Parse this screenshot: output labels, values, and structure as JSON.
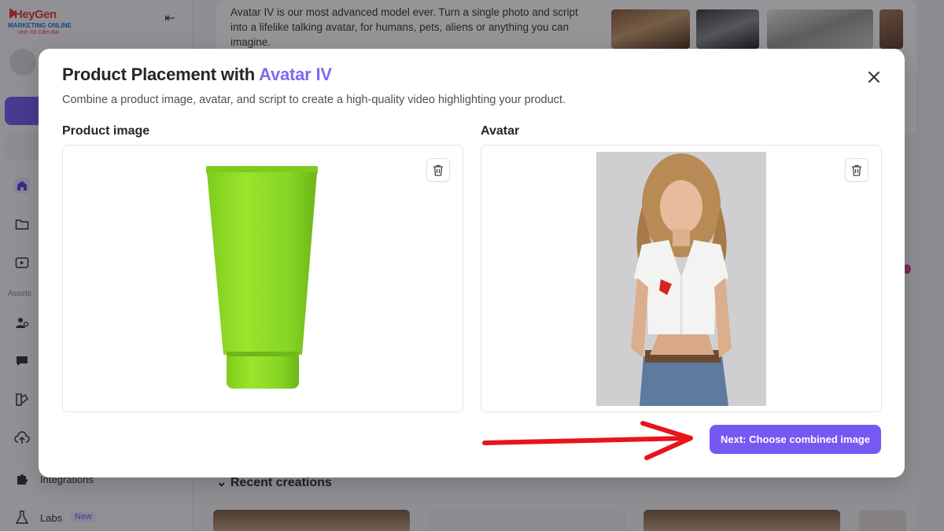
{
  "background": {
    "description_text": "Avatar IV is our most advanced model ever. Turn a single photo and script into a lifelike talking avatar, for humans, pets, aliens or anything you can imagine.",
    "logo": {
      "line1": "HeyGen",
      "line2": "MARKETING ONLINE",
      "line3": "Vinh Xô Cẩm Bài"
    },
    "sidebar": {
      "assets_label": "Assets",
      "integrations_label": "Integrations",
      "labs_label": "Labs",
      "labs_badge": "New",
      "icons": [
        "collapse-icon",
        "home-icon",
        "folder-icon",
        "video-icon",
        "avatar-icon",
        "chat-icon",
        "brand-kit-icon",
        "upload-icon",
        "puzzle-icon",
        "flask-icon"
      ]
    },
    "recent_creations_label": "Recent creations"
  },
  "modal": {
    "title_main": "Product Placement with ",
    "title_accent": "Avatar IV",
    "subtitle": "Combine a product image, avatar, and script to create a high-quality video highlighting your product.",
    "product_label": "Product image",
    "avatar_label": "Avatar",
    "next_button": "Next: Choose combined image",
    "accent_color": "#7559f2",
    "icons": [
      "close-icon",
      "trash-icon"
    ]
  }
}
